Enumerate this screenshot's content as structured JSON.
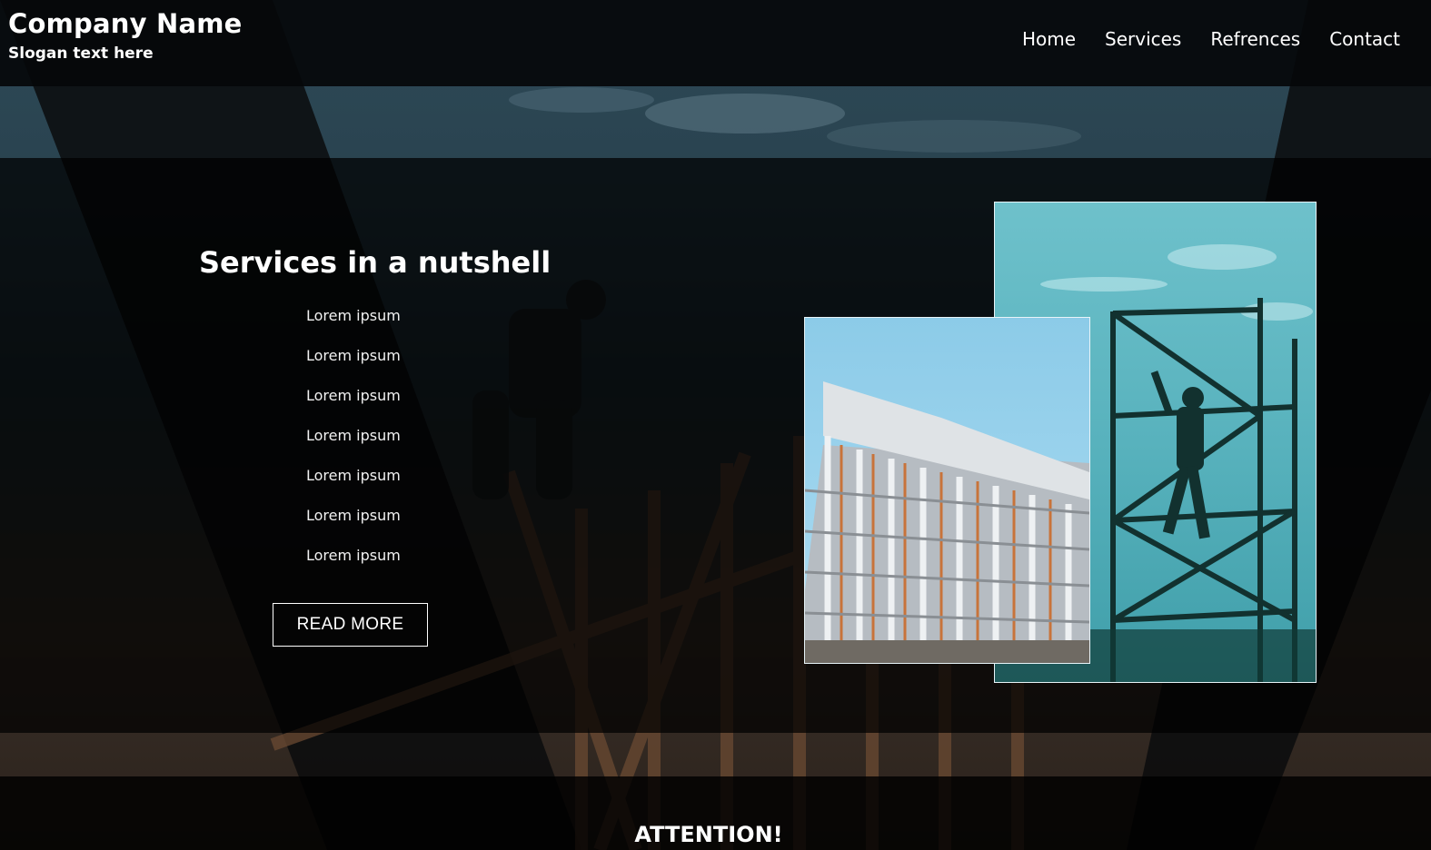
{
  "header": {
    "company_name": "Company Name",
    "slogan": "Slogan text here",
    "nav": [
      "Home",
      "Services",
      "Refrences",
      "Contact"
    ]
  },
  "services": {
    "title": "Services in a nutshell",
    "items": [
      "Lorem ipsum",
      "Lorem ipsum",
      "Lorem ipsum",
      "Lorem ipsum",
      "Lorem ipsum",
      "Lorem ipsum",
      "Lorem ipsum"
    ],
    "read_more_label": "READ MORE"
  },
  "images": {
    "building": "building-under-construction-photo",
    "scaffold": "worker-on-scaffolding-photo",
    "background": "construction-worker-on-timber-frame-photo"
  },
  "notice": {
    "heading": "ATTENTION!"
  },
  "colors": {
    "header_bg": "#05080a",
    "band_bg": "#000000",
    "text": "#ffffff",
    "sky_teal": "#58b2bd",
    "sky_blue": "#9fd5ee"
  }
}
